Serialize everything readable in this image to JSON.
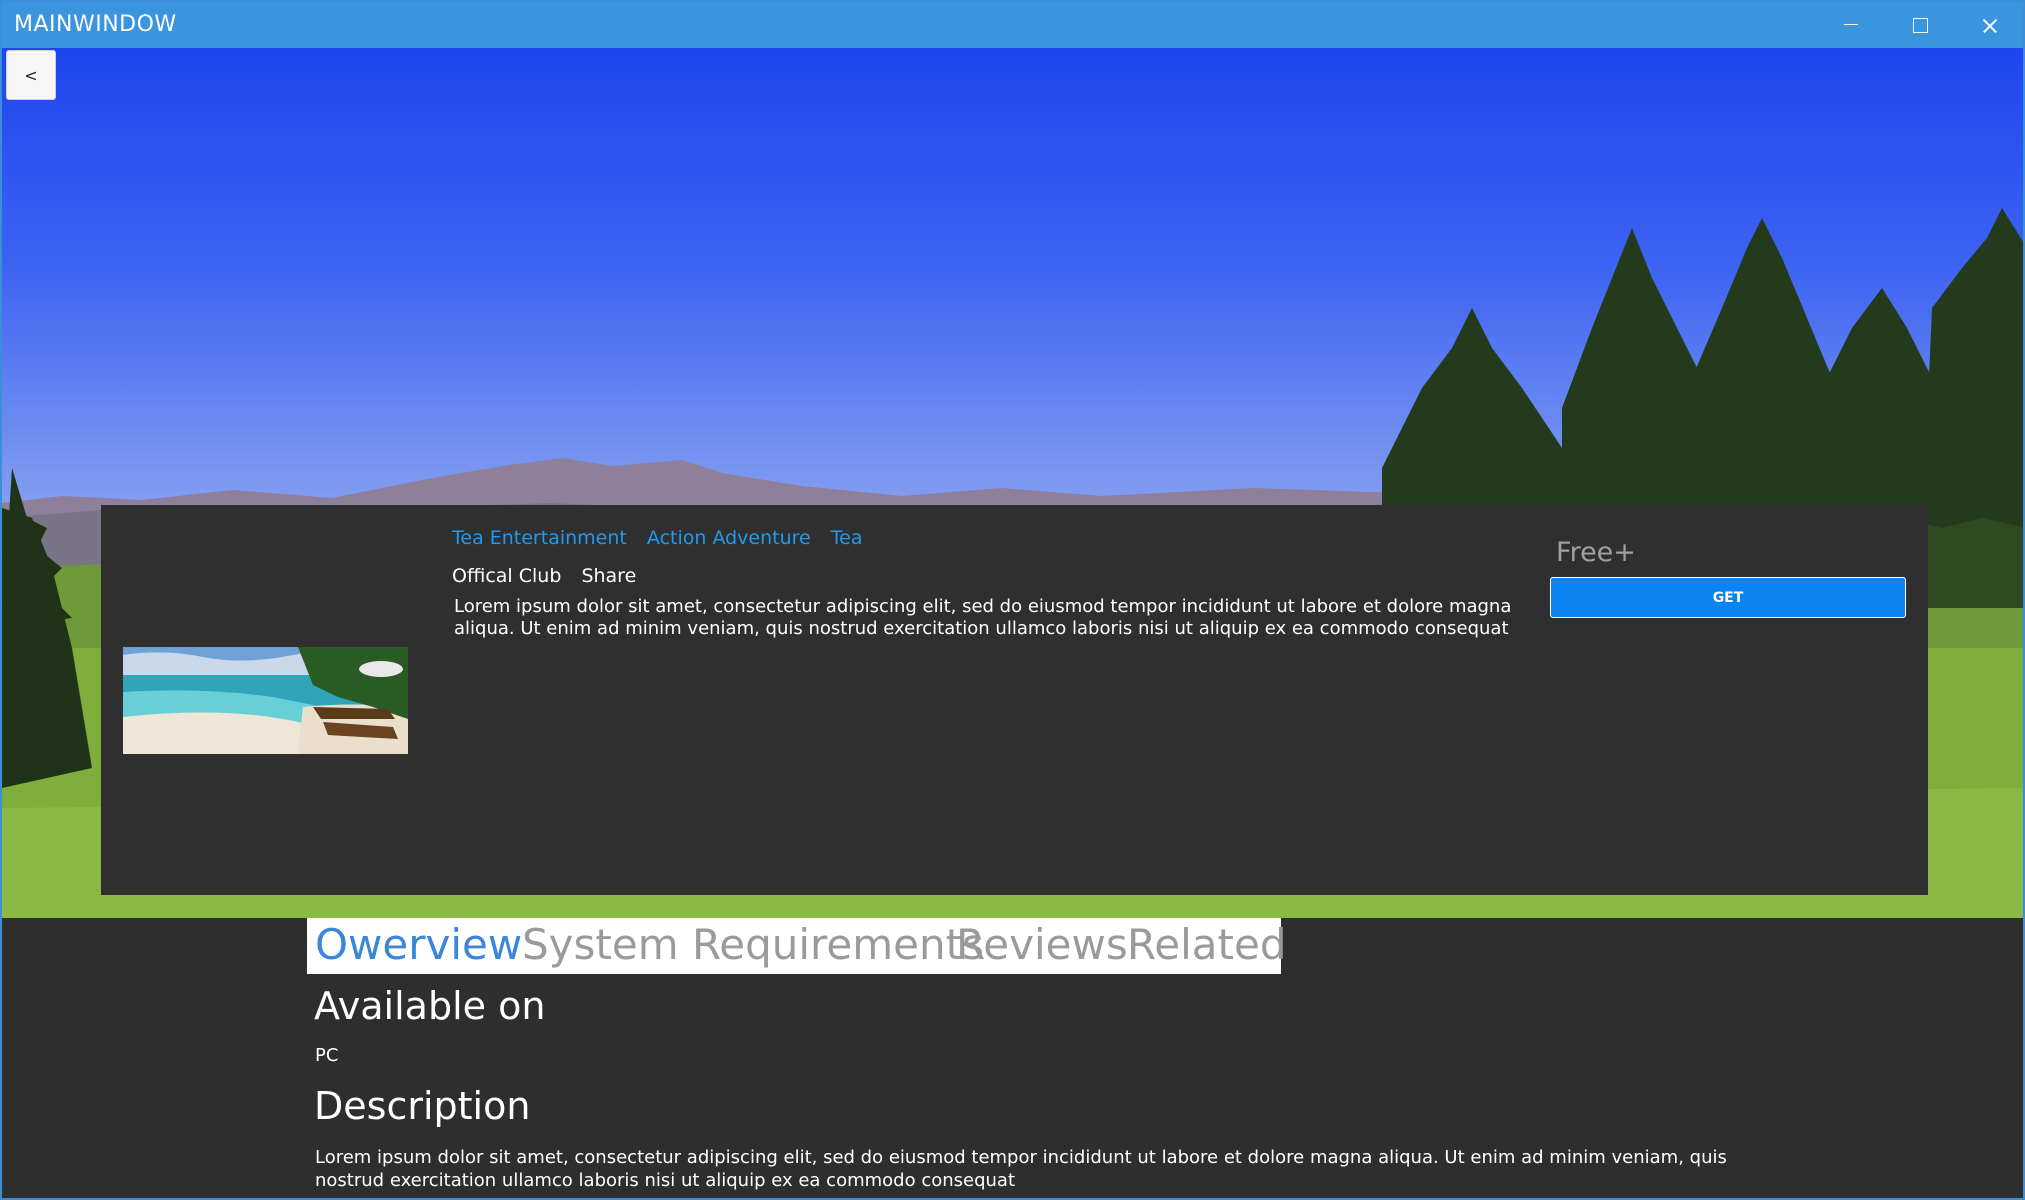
{
  "window": {
    "title": "MAINWINDOW"
  },
  "nav": {
    "back_label": "<"
  },
  "tags": [
    "Tea Entertainment",
    "Action Adventure",
    "Tea"
  ],
  "links": [
    "Offical Club",
    "Share"
  ],
  "card": {
    "description": "Lorem ipsum dolor sit amet, consectetur adipiscing elit, sed do eiusmod tempor incididunt ut labore et dolore magna aliqua. Ut enim ad minim veniam, quis nostrud exercitation ullamco laboris nisi ut aliquip ex ea commodo consequat",
    "price": "Free+",
    "get_label": "GET"
  },
  "tabs": [
    {
      "label": "Owerview",
      "active": true
    },
    {
      "label": "System Requirements",
      "active": false
    },
    {
      "label": "Reviews",
      "active": false
    },
    {
      "label": "Related",
      "active": false
    }
  ],
  "overview": {
    "available_heading": "Available on",
    "platform": "PC",
    "description_heading": "Description",
    "description": "Lorem ipsum dolor sit amet, consectetur adipiscing elit, sed do eiusmod tempor incididunt ut labore et dolore magna aliqua. Ut enim ad minim veniam, quis nostrud exercitation ullamco laboris nisi ut aliquip ex ea commodo consequat"
  },
  "colors": {
    "titlebar": "#3a94de",
    "accent": "#1e9bf0",
    "button": "#0a84f0",
    "panel": "#2f2f2f",
    "active_tab": "#3a86d8"
  }
}
